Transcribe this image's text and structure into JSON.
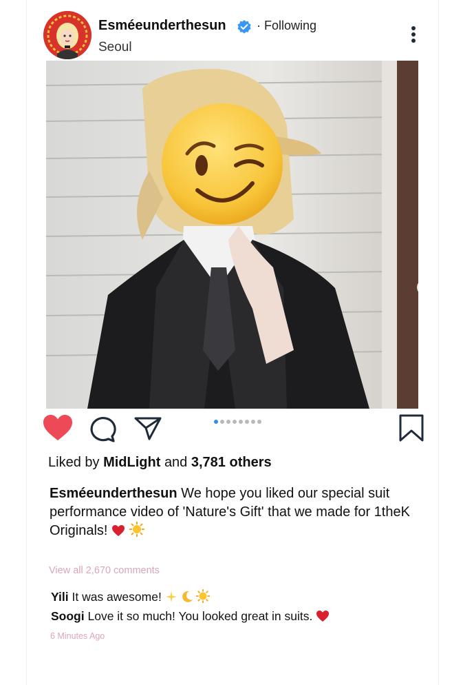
{
  "post": {
    "username": "Esméeunderthesun",
    "follow_status": "· Following",
    "location": "Seoul",
    "liked_by_prefix": "Liked by",
    "liked_by_user": "MidLight",
    "liked_by_and": "and",
    "liked_by_count": "3,781 others",
    "caption_user": "Esméeunderthesun",
    "caption_text": "We hope you liked our special suit performance video of 'Nature's Gift' that we made for 1theK Originals!",
    "caption_emojis": [
      "red-heart",
      "sun-with-face"
    ],
    "view_all_comments": "View all 2,670 comments",
    "comments": [
      {
        "user": "Yili",
        "text": "It was awesome!",
        "emojis": [
          "sparkles",
          "crescent-moon",
          "sun-with-face"
        ]
      },
      {
        "user": "Soogi",
        "text": "Love it so much! You looked great in suits.",
        "emojis": [
          "red-heart"
        ]
      }
    ],
    "timestamp": "6 Minutes Ago",
    "carousel": {
      "count": 8,
      "active_index": 0
    },
    "liked": true
  },
  "colors": {
    "heart": "#ed4956",
    "verified": "#3897f0",
    "active_dot": "#2f8fe8",
    "muted_pink": "#d9a6b9"
  },
  "icons": {
    "more": "more-vertical-icon",
    "like": "heart-icon",
    "comment": "comment-icon",
    "share": "paper-plane-icon",
    "save": "bookmark-icon",
    "next": "chevron-right-icon",
    "verified": "verified-badge-icon",
    "face_cover": "winking-face-emoji"
  }
}
